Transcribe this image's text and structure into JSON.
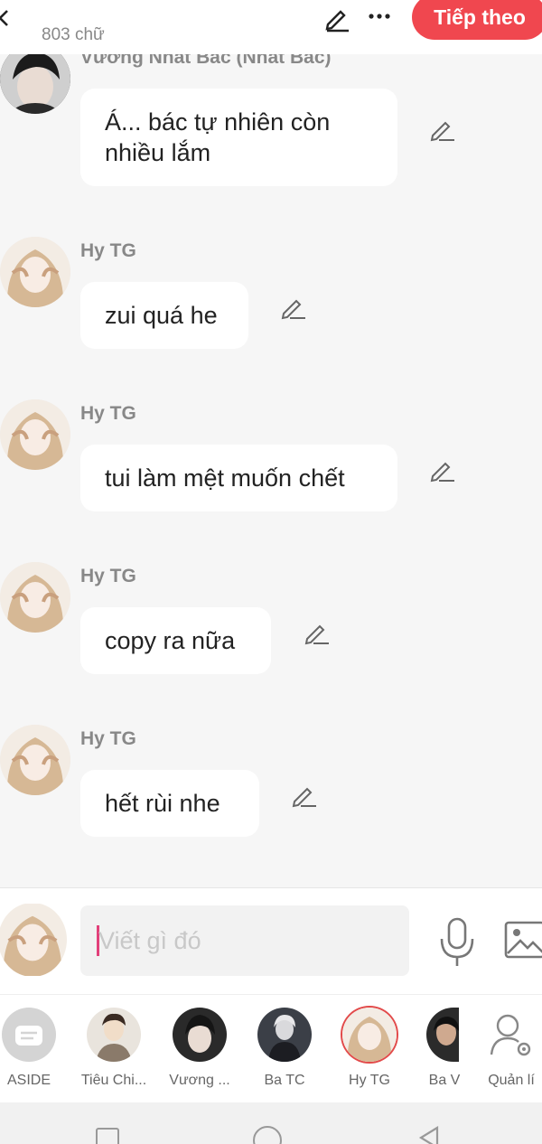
{
  "header": {
    "word_count": "803 chữ",
    "next_label": "Tiếp theo"
  },
  "messages": [
    {
      "sender": "Vương Nhất Bác (Nhất Bác)",
      "text": "Á... bác tự nhiên còn nhiều lắm"
    },
    {
      "sender": "Hy TG",
      "text": "zui quá he"
    },
    {
      "sender": "Hy TG",
      "text": "tui làm mệt muốn chết"
    },
    {
      "sender": "Hy TG",
      "text": "copy ra nữa"
    },
    {
      "sender": "Hy TG",
      "text": "hết rùi nhe"
    }
  ],
  "composer": {
    "placeholder": "Viết gì đó"
  },
  "characters": [
    {
      "name": "ASIDE",
      "icon": "message-icon"
    },
    {
      "name": "Tiêu Chi..."
    },
    {
      "name": "Vương ..."
    },
    {
      "name": "Ba TC"
    },
    {
      "name": "Hy TG",
      "active": true
    },
    {
      "name": "Ba V"
    },
    {
      "name": "Quản lí",
      "icon": "user-settings-icon"
    }
  ],
  "colors": {
    "accent": "#f0474f",
    "caret": "#e2407a"
  }
}
